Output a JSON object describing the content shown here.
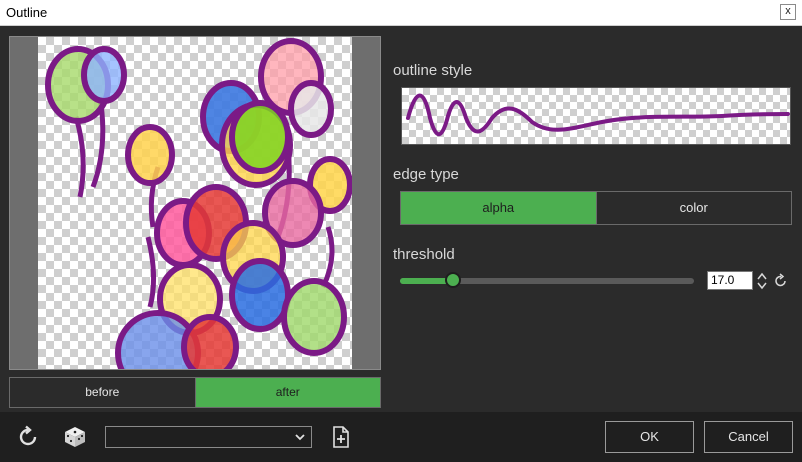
{
  "window": {
    "title": "Outline",
    "close_glyph": "x"
  },
  "preview": {
    "toggle": {
      "before_label": "before",
      "after_label": "after",
      "selected": "after"
    }
  },
  "outline_style": {
    "label": "outline style"
  },
  "edge_type": {
    "label": "edge type",
    "options": [
      "alpha",
      "color"
    ],
    "selected": "alpha"
  },
  "threshold": {
    "label": "threshold",
    "value": "17.0",
    "fraction": 0.18
  },
  "footer": {
    "ok_label": "OK",
    "cancel_label": "Cancel",
    "preset_value": ""
  },
  "colors": {
    "accent": "#4caf50",
    "outline": "#7b1a86",
    "background": "#2b2b2b"
  },
  "icons": [
    "refresh-icon",
    "dice-icon",
    "chevron-down-icon",
    "add-file-icon",
    "up-down-arrows-icon",
    "reset-icon",
    "close-icon"
  ]
}
